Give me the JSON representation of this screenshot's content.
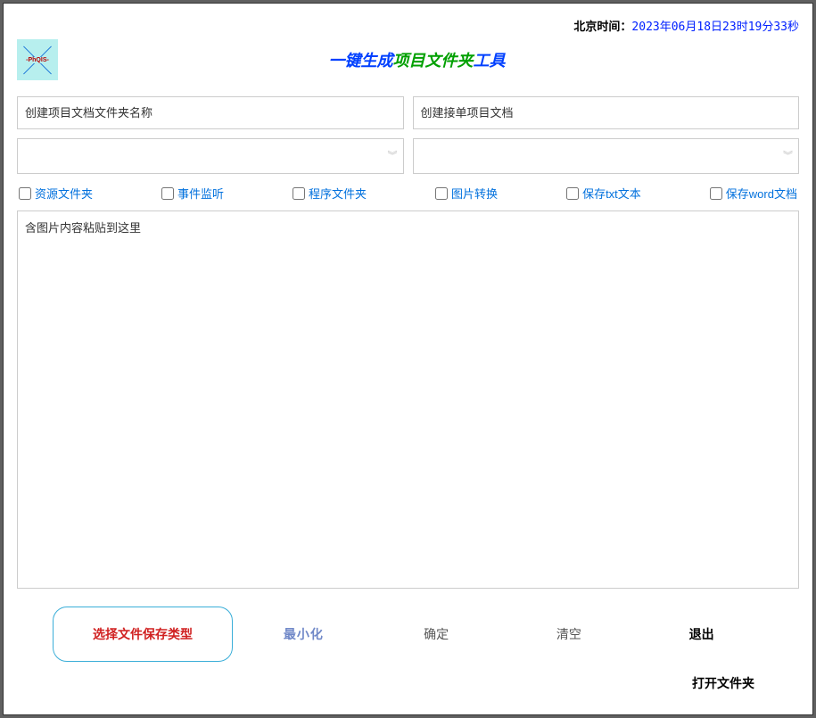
{
  "time": {
    "label": "北京时间：",
    "value": "2023年06月18日23时19分33秒"
  },
  "header": {
    "logo_text": "-PhQIS-",
    "title_part1": "一键生成",
    "title_part2": "项目文件夹",
    "title_part3": "工具"
  },
  "inputs": {
    "folder_name_placeholder": "创建项目文档文件夹名称",
    "receipt_doc_placeholder": "创建接单项目文档"
  },
  "checkboxes": {
    "resource_folder": "资源文件夹",
    "event_listener": "事件监听",
    "program_folder": "程序文件夹",
    "image_convert": "图片转换",
    "save_txt": "保存txt文本",
    "save_word": "保存word文档"
  },
  "paste_area": {
    "placeholder": "含图片内容粘贴到这里"
  },
  "buttons": {
    "select_filetype": "选择文件保存类型",
    "minimize": "最小化",
    "confirm": "确定",
    "clear": "清空",
    "exit": "退出",
    "open_folder": "打开文件夹"
  }
}
